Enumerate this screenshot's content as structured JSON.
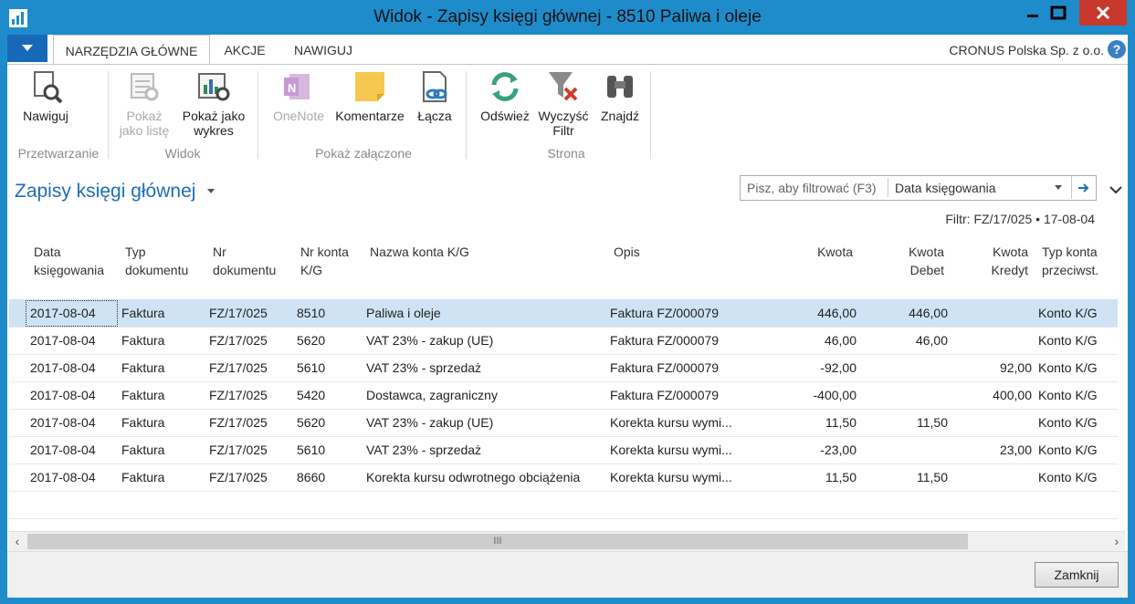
{
  "window": {
    "title": "Widok - Zapisy księgi głównej - 8510 Paliwa i oleje",
    "controls": [
      "minimize-icon",
      "maximize-icon",
      "close-icon"
    ]
  },
  "ribbon": {
    "tabs": [
      "NARZĘDZIA GŁÓWNE",
      "AKCJE",
      "NAWIGUJ"
    ],
    "active_tab": "NARZĘDZIA GŁÓWNE",
    "company": "CRONUS Polska Sp. z o.o.",
    "help": "?",
    "buttons": {
      "nawiguj": "Nawiguj",
      "pokaz_liste": "Pokaż jako listę",
      "pokaz_wykres": "Pokaż jako wykres",
      "onenote": "OneNote",
      "komentarze": "Komentarze",
      "lacza": "Łącza",
      "odswiez": "Odśwież",
      "wyczysc_filtr": "Wyczyść Filtr",
      "znajdz": "Znajdź"
    },
    "groups": {
      "przetwarzanie": "Przetwarzanie",
      "widok": "Widok",
      "pokaz_zalaczone": "Pokaż załączone",
      "strona": "Strona"
    }
  },
  "page": {
    "title": "Zapisy księgi głównej",
    "filter_placeholder": "Pisz, aby filtrować (F3)",
    "filter_field": "Data księgowania",
    "filter_info": "Filtr: FZ/17/025 • 17-08-04",
    "close_button": "Zamknij",
    "scroll_thumb_label": "III"
  },
  "table": {
    "headers": {
      "data": "Data księgowania",
      "typ": "Typ dokumentu",
      "nr": "Nr dokumentu",
      "konto": "Nr konta K/G",
      "nazwa": "Nazwa konta K/G",
      "opis": "Opis",
      "kwota": "Kwota",
      "debet": "Kwota Debet",
      "kredyt": "Kwota Kredyt",
      "typkonta": "Typ konta przeciwst."
    },
    "rows": [
      {
        "data": "2017-08-04",
        "typ": "Faktura",
        "nr": "FZ/17/025",
        "konto": "8510",
        "nazwa": "Paliwa i oleje",
        "opis": "Faktura FZ/000079",
        "kwota": "446,00",
        "debet": "446,00",
        "kredyt": "",
        "typkonta": "Konto K/G"
      },
      {
        "data": "2017-08-04",
        "typ": "Faktura",
        "nr": "FZ/17/025",
        "konto": "5620",
        "nazwa": "VAT 23% - zakup (UE)",
        "opis": "Faktura FZ/000079",
        "kwota": "46,00",
        "debet": "46,00",
        "kredyt": "",
        "typkonta": "Konto K/G"
      },
      {
        "data": "2017-08-04",
        "typ": "Faktura",
        "nr": "FZ/17/025",
        "konto": "5610",
        "nazwa": "VAT 23% - sprzedaż",
        "opis": "Faktura FZ/000079",
        "kwota": "-92,00",
        "debet": "",
        "kredyt": "92,00",
        "typkonta": "Konto K/G"
      },
      {
        "data": "2017-08-04",
        "typ": "Faktura",
        "nr": "FZ/17/025",
        "konto": "5420",
        "nazwa": "Dostawca, zagraniczny",
        "opis": "Faktura FZ/000079",
        "kwota": "-400,00",
        "debet": "",
        "kredyt": "400,00",
        "typkonta": "Konto K/G"
      },
      {
        "data": "2017-08-04",
        "typ": "Faktura",
        "nr": "FZ/17/025",
        "konto": "5620",
        "nazwa": "VAT 23% - zakup (UE)",
        "opis": "Korekta kursu wymi...",
        "kwota": "11,50",
        "debet": "11,50",
        "kredyt": "",
        "typkonta": "Konto K/G"
      },
      {
        "data": "2017-08-04",
        "typ": "Faktura",
        "nr": "FZ/17/025",
        "konto": "5610",
        "nazwa": "VAT 23% - sprzedaż",
        "opis": "Korekta kursu wymi...",
        "kwota": "-23,00",
        "debet": "",
        "kredyt": "23,00",
        "typkonta": "Konto K/G"
      },
      {
        "data": "2017-08-04",
        "typ": "Faktura",
        "nr": "FZ/17/025",
        "konto": "8660",
        "nazwa": "Korekta kursu odwrotnego obciążenia",
        "opis": "Korekta kursu wymi...",
        "kwota": "11,50",
        "debet": "11,50",
        "kredyt": "",
        "typkonta": "Konto K/G"
      }
    ]
  },
  "colors": {
    "titlebar": "#1e8ccb",
    "accent": "#1c6fb8",
    "selected_row": "#cfe3f5",
    "close": "#c7392d"
  }
}
